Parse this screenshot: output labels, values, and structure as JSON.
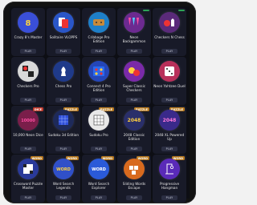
{
  "play_label": "PLAY",
  "games": [
    {
      "title": "Crazy 8's Master",
      "tag": "",
      "tag_color": "",
      "icon": "crazy-eights-icon",
      "bg": "#3a4fd8"
    },
    {
      "title": "Solitaire VLOPPS",
      "tag": "",
      "tag_color": "",
      "icon": "solitaire-icon",
      "bg": "#2a56c8"
    },
    {
      "title": "Cribbage Pro Edition",
      "tag": "",
      "tag_color": "",
      "icon": "cribbage-icon",
      "bg": "#1e7fc8"
    },
    {
      "title": "Neon Backgammon",
      "tag": "",
      "tag_color": "#2ea356",
      "icon": "backgammon-icon",
      "bg": "#6c2a90"
    },
    {
      "title": "Checkers N Chess",
      "tag": "",
      "tag_color": "#2ea356",
      "icon": "checkers-chess-icon",
      "bg": "#5a2a7a"
    },
    {
      "title": "Checkers Pro",
      "tag": "",
      "tag_color": "",
      "icon": "checkers-icon",
      "bg": "#d9d9d9"
    },
    {
      "title": "Chess Pro",
      "tag": "",
      "tag_color": "",
      "icon": "chess-icon",
      "bg": "#1f3a8a"
    },
    {
      "title": "Connect 4 Pro Edition",
      "tag": "",
      "tag_color": "",
      "icon": "connect-four-icon",
      "bg": "#2446b8"
    },
    {
      "title": "Super Classic Checkers",
      "tag": "",
      "tag_color": "",
      "icon": "super-checkers-icon",
      "bg": "#7a2aa8"
    },
    {
      "title": "Neon Yahtzee Duel",
      "tag": "",
      "tag_color": "",
      "icon": "dice-icon",
      "bg": "#b8305a"
    },
    {
      "title": "10,000 Neon Dice",
      "tag": "DICE",
      "tag_color": "#c0392b",
      "icon": "neon-dice-icon",
      "bg": "#7a1e4a"
    },
    {
      "title": "Sudoku 3d Edition",
      "tag": "PUZZLE",
      "tag_color": "#b7791f",
      "icon": "sudoku-3d-icon",
      "bg": "#1e2a5a"
    },
    {
      "title": "Sudoku Pro",
      "tag": "PUZZLE",
      "tag_color": "#b7791f",
      "icon": "sudoku-icon",
      "bg": "#e8e8e8"
    },
    {
      "title": "2048 Classic Edition",
      "tag": "PUZZLE",
      "tag_color": "#b7791f",
      "icon": "tiles-2048-icon",
      "bg": "#2a2f6a"
    },
    {
      "title": "2048 XL Powered Up",
      "tag": "PUZZLE",
      "tag_color": "#b7791f",
      "icon": "tiles-2048-xl-icon",
      "bg": "#3a2a8a"
    },
    {
      "title": "Crossword Puzzle Master",
      "tag": "WORD",
      "tag_color": "#b7791f",
      "icon": "crossword-icon",
      "bg": "#2a3a9a"
    },
    {
      "title": "Word Search Legends",
      "tag": "WORD",
      "tag_color": "#b7791f",
      "icon": "word-search-icon",
      "bg": "#3050c8"
    },
    {
      "title": "Word Search Explorer",
      "tag": "WORD",
      "tag_color": "#b7791f",
      "icon": "word-explorer-icon",
      "bg": "#2a5ad8"
    },
    {
      "title": "Sliding Words Escape",
      "tag": "WORD",
      "tag_color": "#b7791f",
      "icon": "sliding-words-icon",
      "bg": "#d86a1e"
    },
    {
      "title": "Progressive Hangman",
      "tag": "WORD",
      "tag_color": "#b7791f",
      "icon": "hangman-icon",
      "bg": "#5a2ab8"
    }
  ]
}
